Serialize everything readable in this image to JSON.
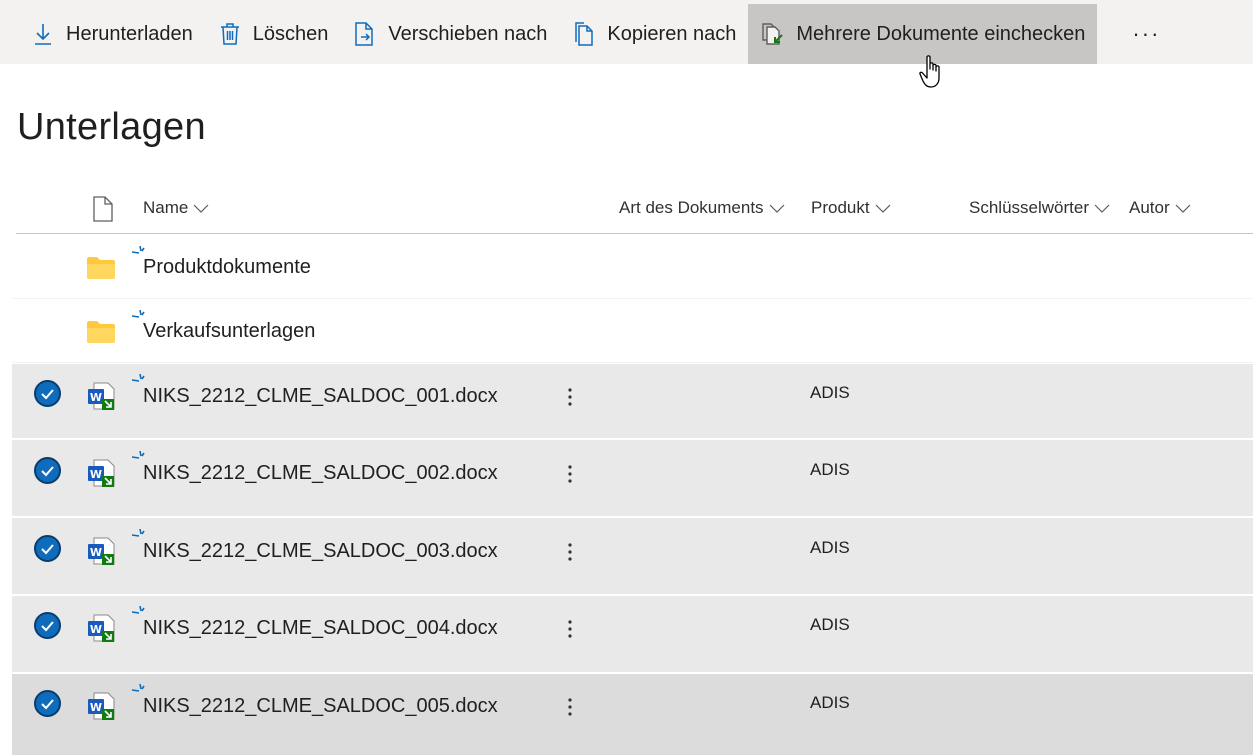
{
  "toolbar": {
    "download_label": "Herunterladen",
    "delete_label": "Löschen",
    "move_label": "Verschieben nach",
    "copy_label": "Kopieren nach",
    "checkin_label": "Mehrere Dokumente einchecken",
    "more_label": "···"
  },
  "page": {
    "title": "Unterlagen"
  },
  "columns": {
    "name": "Name",
    "doc_type": "Art des Dokuments",
    "product": "Produkt",
    "keywords": "Schlüsselwörter",
    "author": "Autor"
  },
  "folders": [
    {
      "name": "Produktdokumente"
    },
    {
      "name": "Verkaufsunterlagen"
    }
  ],
  "files": [
    {
      "name": "NIKS_2212_CLME_SALDOC_001.docx",
      "product": "ADIS"
    },
    {
      "name": "NIKS_2212_CLME_SALDOC_002.docx",
      "product": "ADIS"
    },
    {
      "name": "NIKS_2212_CLME_SALDOC_003.docx",
      "product": "ADIS"
    },
    {
      "name": "NIKS_2212_CLME_SALDOC_004.docx",
      "product": "ADIS"
    },
    {
      "name": "NIKS_2212_CLME_SALDOC_005.docx",
      "product": "ADIS"
    }
  ],
  "colors": {
    "accent": "#0f6cbd",
    "toolbar_bg": "#f3f2f1",
    "selected_row_bg": "#e9e9e9",
    "folder_yellow": "#ffc83d",
    "word_blue": "#185abd",
    "checkin_green": "#107c10"
  }
}
